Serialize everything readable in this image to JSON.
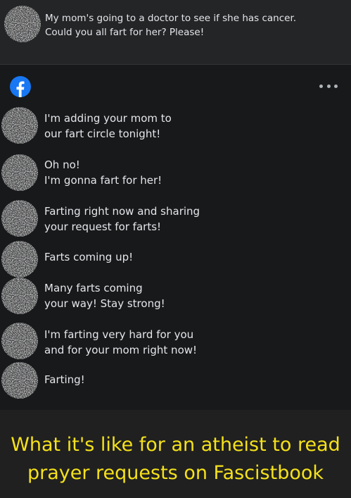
{
  "post": {
    "avatar_icon": "blurred-avatar-icon",
    "lines": [
      "My mom's going to a doctor to see if she has cancer.",
      "Could you all fart for her? Please!"
    ]
  },
  "comments_header": {
    "logo_icon": "facebook-logo-icon",
    "more_icon": "more-options-icon"
  },
  "comments": [
    {
      "lines": [
        "I'm adding your mom to",
        "our fart circle tonight!"
      ]
    },
    {
      "lines": [
        "Oh no!",
        "I'm gonna fart for her!"
      ]
    },
    {
      "lines": [
        "Farting right now and sharing",
        "your request for farts!"
      ]
    },
    {
      "lines": [
        "Farts coming up!"
      ]
    },
    {
      "lines": [
        "Many farts coming",
        "your way! Stay strong!"
      ]
    },
    {
      "lines": [
        "I'm farting very hard for you",
        "and for your mom right now!"
      ]
    },
    {
      "lines": [
        "Farting!"
      ]
    }
  ],
  "caption": {
    "lines": [
      "What it's like for an atheist to read",
      "prayer requests on Fascistbook"
    ]
  },
  "colors": {
    "background": "#202020",
    "card": "#242526",
    "panel": "#18191a",
    "text": "#e4e6eb",
    "facebook_blue": "#1877f2",
    "caption": "#f5e11a"
  }
}
